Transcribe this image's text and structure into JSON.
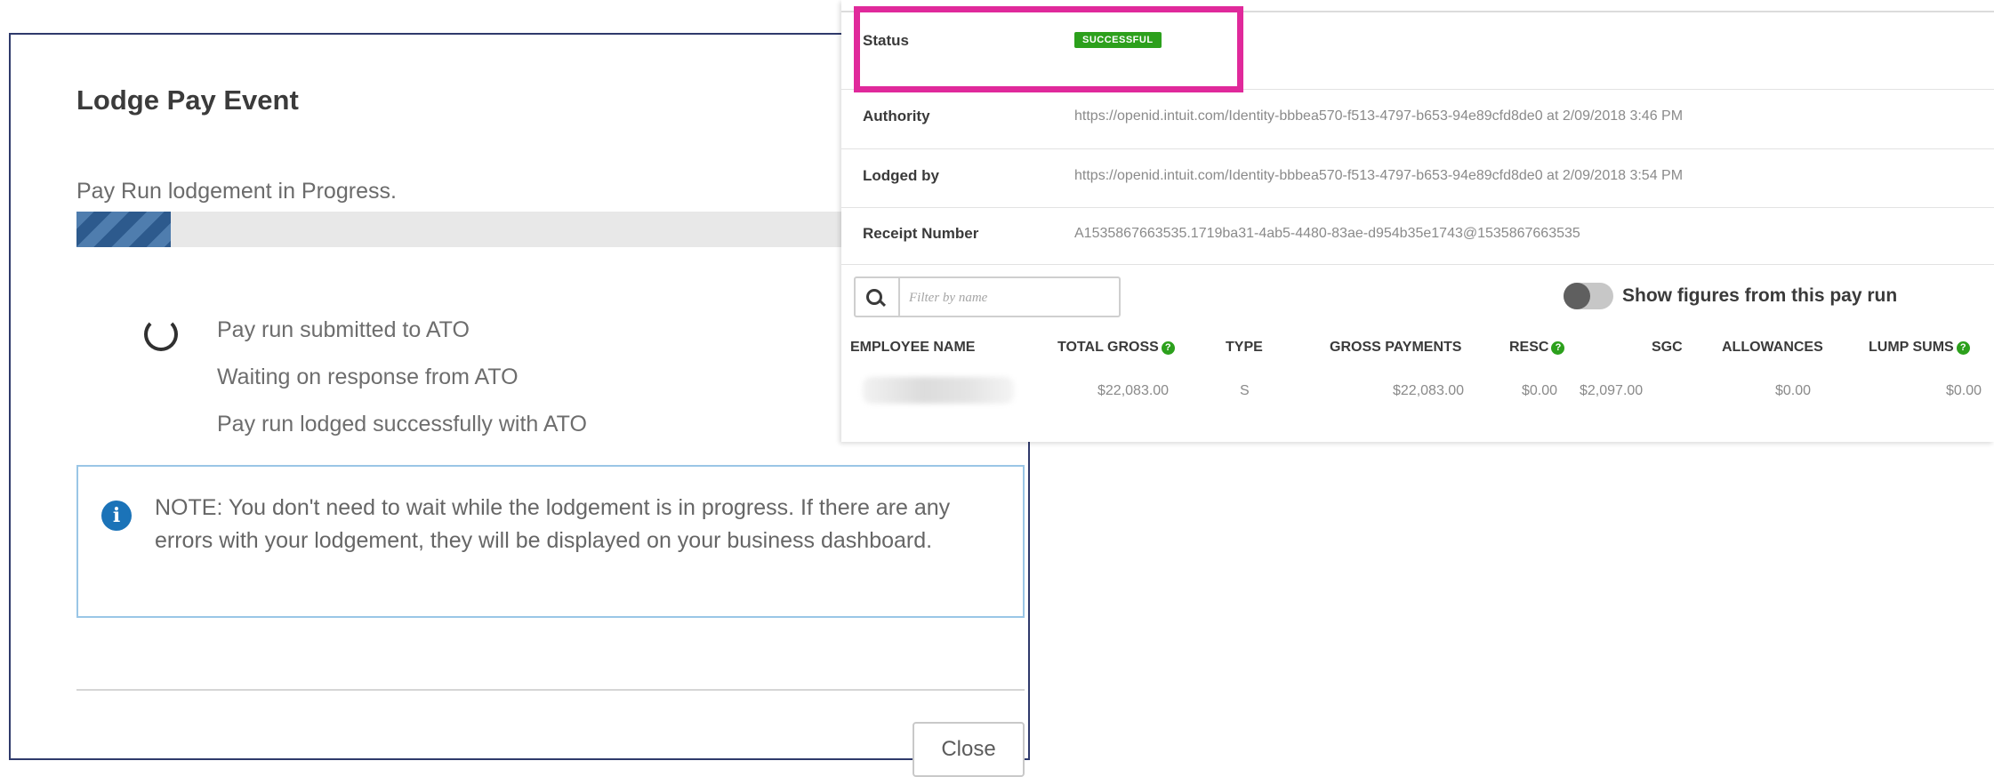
{
  "modal": {
    "title": "Lodge Pay Event",
    "progress_text": "Pay Run lodgement in Progress.",
    "progress_fraction": 0.12,
    "steps": [
      "Pay run submitted to ATO",
      "Waiting on response from ATO",
      "Pay run lodged successfully with ATO"
    ],
    "note": "NOTE: You don't need to wait while the lodgement is in progress. If there are any errors with your lodgement, they will be displayed on your business dashboard.",
    "note_icon": "info-icon",
    "close_label": "Close"
  },
  "details": {
    "status_label": "Status",
    "status_value": "SUCCESSFUL",
    "authority_label": "Authority",
    "authority_value": "https://openid.intuit.com/Identity-bbbea570-f513-4797-b653-94e89cfd8de0 at 2/09/2018 3:46 PM",
    "lodged_by_label": "Lodged by",
    "lodged_by_value": "https://openid.intuit.com/Identity-bbbea570-f513-4797-b653-94e89cfd8de0 at 2/09/2018 3:54 PM",
    "receipt_label": "Receipt Number",
    "receipt_value": "A1535867663535.1719ba31-4ab5-4480-83ae-d954b35e1743@1535867663535"
  },
  "filter": {
    "placeholder": "Filter by name",
    "icon": "search-icon"
  },
  "toggle": {
    "label": "Show figures from this pay run",
    "on": false
  },
  "table": {
    "columns": [
      "EMPLOYEE NAME",
      "TOTAL GROSS",
      "TYPE",
      "GROSS PAYMENTS",
      "RESC",
      "SGC",
      "ALLOWANCES",
      "LUMP SUMS"
    ],
    "rows": [
      {
        "employee_name": "",
        "total_gross": "$22,083.00",
        "type": "S",
        "gross_payments": "$22,083.00",
        "resc": "$0.00",
        "sgc": "$2,097.00",
        "allowances": "$0.00",
        "lump_sums": "$0.00"
      }
    ]
  },
  "colors": {
    "status_badge": "#2ca01c",
    "highlight_border": "#e0299b",
    "modal_border": "#2f3a6b",
    "info_icon": "#1b73b8"
  }
}
